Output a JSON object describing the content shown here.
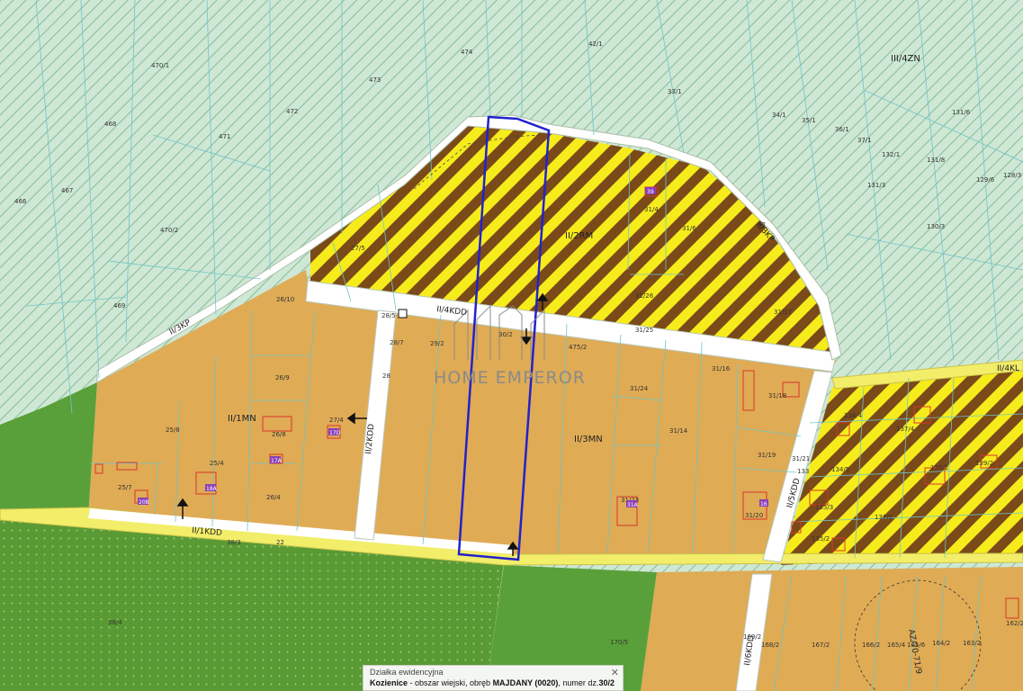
{
  "zones": {
    "rm": "II/2RM",
    "mn1": "II/1MN",
    "mn3": "II/3MN",
    "zn": "III/4ZN",
    "kp3": "II/3KP",
    "kp_right": "II/3KP",
    "kdd1": "II/1KDD",
    "kdd2": "II/2KDD",
    "kdd4": "II/4KDD",
    "kdd6": "II/6KDD",
    "kdd_r": "II/5KDD",
    "zn_r": "II/4KL",
    "az": "AZ/70-71/9"
  },
  "watermark": "HOME EMPEROR",
  "parcels": {
    "p474": "474",
    "p473": "473",
    "p472": "472",
    "p471": "471",
    "p470_1": "470/1",
    "p470_2": "470/2",
    "p468": "468",
    "p467": "467",
    "p466": "466",
    "p469": "469",
    "p42_1": "42/1",
    "p33_1": "33/1",
    "p34_1": "34/1",
    "p35_1": "35/1",
    "p36_1": "36/1",
    "p37_1": "37/1",
    "p132_1": "132/1",
    "p131_8": "131/8",
    "p131_6": "131/6",
    "p129_6": "129/6",
    "p128_3": "128/3",
    "p130_3": "130/3",
    "p131_3": "131/3",
    "p27_5": "27/5",
    "p26_10": "26/10",
    "p28_5": "28/5",
    "p28_7": "28/7",
    "p29_2": "29/2",
    "p30_2": "30/2",
    "p475_2": "475/2",
    "p31_4": "31/4",
    "p31_6": "31/6",
    "p31_26": "31/26",
    "p31_25": "31/25",
    "p31_17": "31/17",
    "p32": "32",
    "p26_9": "26/9",
    "p27_4": "27/4",
    "p26_8": "26/8",
    "p25_8": "25/8",
    "p25_4": "25/4",
    "p25_7": "25/7",
    "p26_4": "26/4",
    "p31_16": "31/16",
    "p31_24": "31/24",
    "p31_18": "31/18",
    "p31_14": "31/14",
    "p31_19": "31/19",
    "p31_21": "31/21",
    "p31_23": "31/23",
    "p31_20": "31/20",
    "p134_4": "134/4",
    "p137_4": "137/4",
    "p134_5": "134/5",
    "p138_2": "138/2",
    "p139_2": "139/2",
    "p135_3": "135/3",
    "p135_2": "135/2",
    "p137_2": "137/2",
    "p133": "133",
    "p38_3": "38/3",
    "p22": "22",
    "p38_4": "38/4",
    "p170_5": "170/5",
    "p169_2": "169/2",
    "p168_2": "168/2",
    "p167_2": "167/2",
    "p166_2": "166/2",
    "p165_4": "165/4",
    "p165_6": "165/6",
    "p164_2": "164/2",
    "p163_2": "163/2",
    "p162_2": "162/2",
    "p28": "28",
    "p40": "40"
  },
  "buildings": {
    "b17d": "17D",
    "b17a": "17A",
    "b18a": "18A",
    "b20b": "20B",
    "b39": "39",
    "b31a": "31A",
    "b16": "16"
  },
  "popup": {
    "title": "Działka ewidencyjna",
    "obreb_place": "Kozienice",
    "obreb_sep1": " - obszar wiejski",
    "obreb_sep2": ", obręb ",
    "obreb_name": "MAJDANY (0020)",
    "obreb_tail": ", numer dz.",
    "parcel_no": "30/2",
    "close": "✕"
  },
  "colors": {
    "forest_hatch_bg": "#c7e3cf",
    "forest_hatch_line": "#8ec39a",
    "residential": "#deaa52",
    "rm_yellow": "#f6ec1c",
    "rm_brown": "#7a4a18",
    "green": "#5aa03a",
    "road_yellow": "#f2ee6a",
    "selection": "#2222cc",
    "building": "#d9362a"
  }
}
